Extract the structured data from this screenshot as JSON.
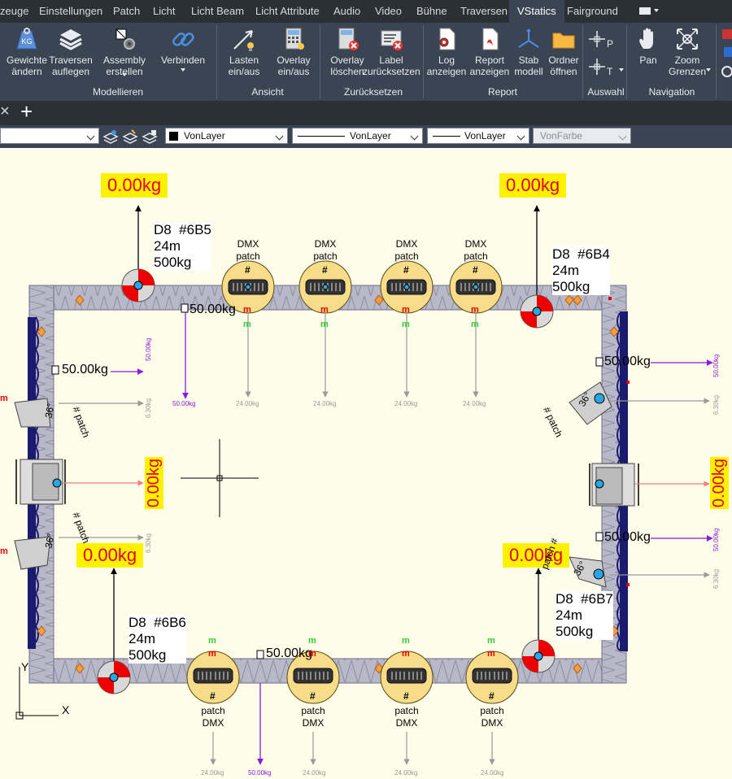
{
  "ribbon_tabs": [
    "zeuge",
    "Einstellungen",
    "Patch",
    "Licht",
    "Licht Beam",
    "Licht Attribute",
    "Audio",
    "Video",
    "Bühne",
    "Traversen",
    "VStatics",
    "Fairground"
  ],
  "active_tab": "VStatics",
  "ribbon": {
    "buttons": [
      {
        "id": "gewichte",
        "label": "Gewichte\nändern",
        "icon": "weight-kg-icon"
      },
      {
        "id": "traversen",
        "label": "Traversen\nauflegen",
        "icon": "layers-icon"
      },
      {
        "id": "assembly",
        "label": "Assembly\nerstellen",
        "icon": "assembly-icon"
      },
      {
        "id": "verbinden",
        "label": "Verbinden",
        "icon": "link-icon"
      },
      {
        "id": "lasten",
        "label": "Lasten\nein/aus",
        "icon": "load-arrow-icon"
      },
      {
        "id": "overlay",
        "label": "Overlay\nein/aus",
        "icon": "overlay-calculator-icon"
      },
      {
        "id": "overlay_del",
        "label": "Overlay\nlöschen",
        "icon": "overlay-delete-icon"
      },
      {
        "id": "label_reset",
        "label": "Label\nzurücksetzen",
        "icon": "label-reset-icon"
      },
      {
        "id": "log",
        "label": "Log\nanzeigen",
        "icon": "log-icon"
      },
      {
        "id": "report",
        "label": "Report\nanzeigen",
        "icon": "pdf-report-icon"
      },
      {
        "id": "stab",
        "label": "Stab\nmodell",
        "icon": "axes-icon"
      },
      {
        "id": "ordner",
        "label": "Ordner\nöffnen",
        "icon": "folder-icon"
      },
      {
        "id": "pan",
        "label": "Pan",
        "icon": "hand-pan-icon"
      },
      {
        "id": "zoom",
        "label": "Zoom\nGrenzen",
        "icon": "zoom-extents-icon"
      }
    ],
    "groups": [
      "Modellieren",
      "Ansicht",
      "Zurücksetzen",
      "Report",
      "Auswahl",
      "Navigation"
    ]
  },
  "doc_tabs": {
    "close": "×",
    "add": "+"
  },
  "properties": {
    "color": "VonLayer",
    "linetype": "VonLayer",
    "lineweight": "VonLayer",
    "plotstyle": "VonFarbe"
  },
  "drawing": {
    "hoists": [
      {
        "id": "D8  #6B5",
        "length": "24m",
        "capacity": "500kg",
        "load": "0.00kg"
      },
      {
        "id": "D8  #6B4",
        "length": "24m",
        "capacity": "500kg",
        "load": "0.00kg"
      },
      {
        "id": "D8  #6B6",
        "length": "24m",
        "capacity": "500kg",
        "load": "0.00kg"
      },
      {
        "id": "D8  #6B7",
        "length": "24m",
        "capacity": "500kg",
        "load": "0.00kg"
      }
    ],
    "side_loads": {
      "left": "0.00kg",
      "right": "0.00kg"
    },
    "point_loads": "50.00kg",
    "small_loads": {
      "purple": "50.00kg",
      "grey": "24.00kg",
      "side": "6.30kg"
    },
    "fixture_labels": {
      "dmx": "DMX",
      "patch": "patch",
      "hash": "#",
      "m": "m",
      "angle": "36°"
    },
    "ucs": {
      "y": "Y",
      "x": "X"
    }
  }
}
